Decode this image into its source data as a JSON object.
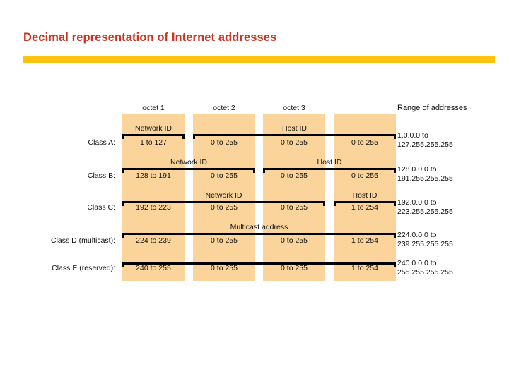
{
  "slide": {
    "title": "Decimal representation of Internet addresses",
    "accent_color": "#ffc20e",
    "title_color": "#cc3322",
    "cell_color": "#fad49b"
  },
  "table": {
    "column_headers": [
      "octet 1",
      "octet 2",
      "octet 3",
      ""
    ],
    "range_header": "Range of addresses",
    "rows": [
      {
        "class_label": "Class A:",
        "octets": [
          "1 to 127",
          "0 to 255",
          "0 to 255",
          "0 to 255"
        ],
        "spans": [
          {
            "label": "Network ID",
            "start": 0,
            "end": 0
          },
          {
            "label": "Host ID",
            "start": 1,
            "end": 3
          }
        ],
        "range": [
          "1.0.0.0 to",
          "127.255.255.255"
        ]
      },
      {
        "class_label": "Class B:",
        "octets": [
          "128 to 191",
          "0 to 255",
          "0 to 255",
          "0 to 255"
        ],
        "spans": [
          {
            "label": "Network ID",
            "start": 0,
            "end": 1
          },
          {
            "label": "Host ID",
            "start": 2,
            "end": 3
          }
        ],
        "range": [
          "128.0.0.0 to",
          "191.255.255.255"
        ]
      },
      {
        "class_label": "Class C:",
        "octets": [
          "192 to 223",
          "0 to 255",
          "0 to 255",
          "1 to 254"
        ],
        "spans": [
          {
            "label": "Network ID",
            "start": 0,
            "end": 2
          },
          {
            "label": "Host ID",
            "start": 3,
            "end": 3
          }
        ],
        "range": [
          "192.0.0.0 to",
          "223.255.255.255"
        ]
      },
      {
        "class_label": "Class D (multicast):",
        "octets": [
          "224 to 239",
          "0 to 255",
          "0 to 255",
          "1 to 254"
        ],
        "spans": [
          {
            "label": "Multicast address",
            "start": 0,
            "end": 3
          }
        ],
        "range": [
          "224.0.0.0 to",
          "239.255.255.255"
        ]
      },
      {
        "class_label": "Class E (reserved):",
        "octets": [
          "240 to 255",
          "0 to 255",
          "0 to 255",
          "1 to 254"
        ],
        "spans": [
          {
            "label": "",
            "start": 0,
            "end": 3
          }
        ],
        "range": [
          "240.0.0.0 to",
          "255.255.255.255"
        ]
      }
    ]
  }
}
